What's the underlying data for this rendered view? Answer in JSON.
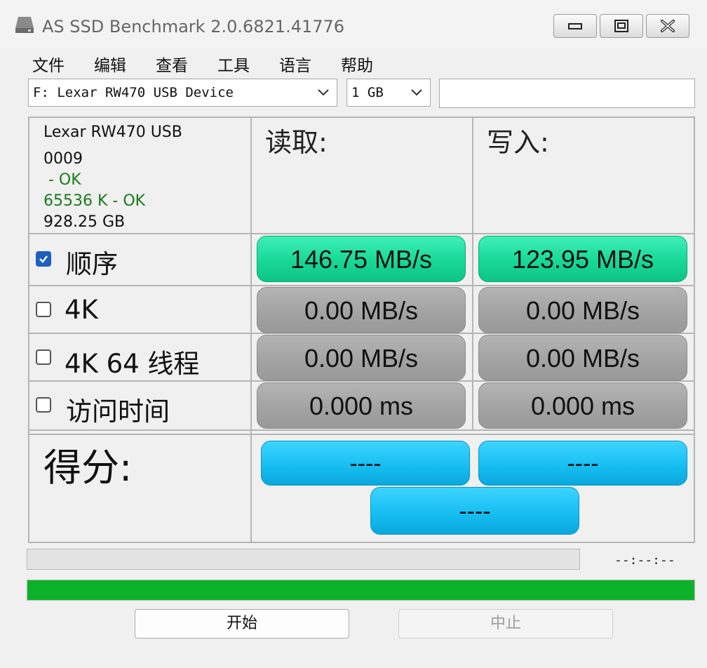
{
  "window": {
    "title": "AS SSD Benchmark 2.0.6821.41776"
  },
  "menu": [
    "文件",
    "编辑",
    "查看",
    "工具",
    "语言",
    "帮助"
  ],
  "drive_select": {
    "value": "F: Lexar RW470 USB Device"
  },
  "size_select": {
    "value": "1 GB"
  },
  "drive_info": {
    "name": "Lexar RW470 USB",
    "firmware": "0009",
    "driver_status": " - OK",
    "alignment": "65536 K - OK",
    "capacity": "928.25 GB"
  },
  "columns": {
    "read": "读取:",
    "write": "写入:"
  },
  "tests": [
    {
      "label": "顺序",
      "checked": true,
      "read": "146.75 MB/s",
      "write": "123.95 MB/s"
    },
    {
      "label": "4K",
      "checked": false,
      "read": "0.00 MB/s",
      "write": "0.00 MB/s"
    },
    {
      "label": "4K 64 线程",
      "checked": false,
      "read": "0.00 MB/s",
      "write": "0.00 MB/s"
    },
    {
      "label": "访问时间",
      "checked": false,
      "read": "0.000 ms",
      "write": "0.000 ms"
    }
  ],
  "score": {
    "label": "得分:",
    "read": "----",
    "write": "----",
    "total": "----"
  },
  "progress": {
    "elapsed_time": "--:--:--",
    "overall_fraction": 1.0,
    "current_fraction": 0.0
  },
  "buttons": {
    "start": "开始",
    "abort": "中止"
  },
  "colors": {
    "result_green": "#17d898",
    "result_gray": "#a3a3a3",
    "score_blue": "#17bff3",
    "progress_green": "#0cb32a",
    "checkbox_blue": "#1e5fbf"
  }
}
